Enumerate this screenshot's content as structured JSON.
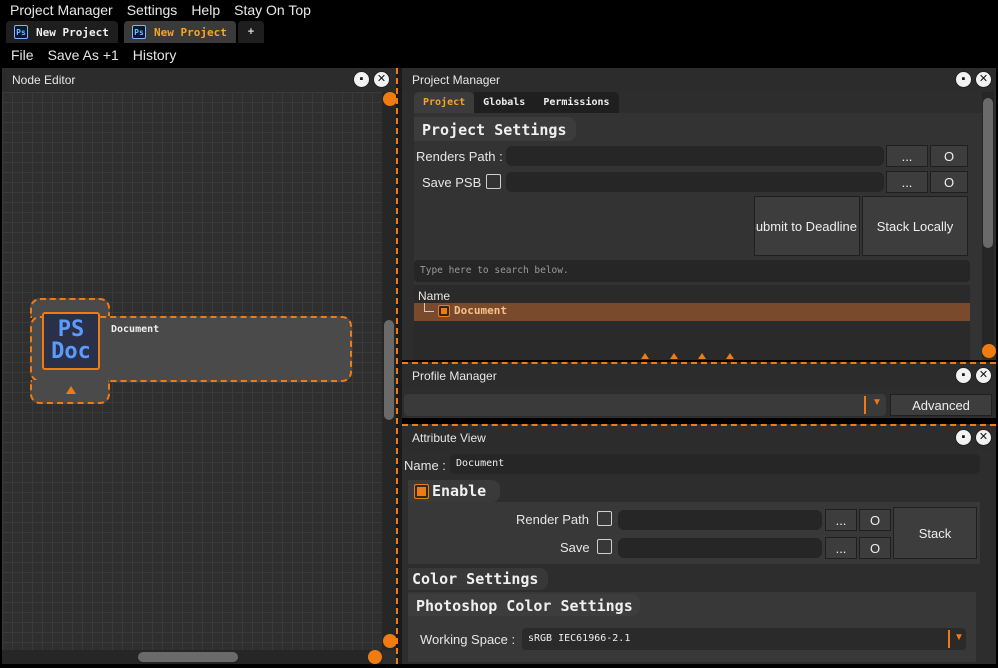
{
  "menubar": [
    "Project Manager",
    "Settings",
    "Help",
    "Stay On Top"
  ],
  "tabs": [
    {
      "label": "New Project",
      "active": false
    },
    {
      "label": "New Project",
      "active": true
    }
  ],
  "tab_add": "+",
  "ps_icon": "Ps",
  "filebar": [
    "File",
    "Save As +1",
    "History"
  ],
  "node_editor": {
    "title": "Node Editor",
    "node": {
      "icon_line1": "PS",
      "icon_line2": "Doc",
      "label": "Document"
    }
  },
  "project_manager": {
    "title": "Project Manager",
    "tabs": [
      "Project",
      "Globals",
      "Permissions"
    ],
    "heading": "Project Settings",
    "renders_path_label": "Renders Path :",
    "save_psb_label": "Save PSB",
    "browse_label": "...",
    "open_label": "O",
    "submit_label": "Submit to Deadline",
    "stack_locally_label": "Stack Locally",
    "search_placeholder": "Type here to search below.",
    "tree_header": "Name",
    "tree_item": "Document"
  },
  "profile_manager": {
    "title": "Profile Manager",
    "dropdown_value": "",
    "advanced_label": "Advanced"
  },
  "attribute_view": {
    "title": "Attribute View",
    "name_label": "Name :",
    "name_value": "Document",
    "enable_label": "Enable",
    "render_path_label": "Render Path",
    "save_label": "Save",
    "browse_label": "...",
    "open_label": "O",
    "stack_label": "Stack",
    "color_settings": "Color Settings",
    "ps_color_settings": "Photoshop Color Settings",
    "working_space_label": "Working Space :",
    "working_space_value": "sRGB IEC61966-2.1"
  },
  "colors": {
    "accent": "#f07b10",
    "panel": "#2d2d2d",
    "field": "#262626"
  }
}
